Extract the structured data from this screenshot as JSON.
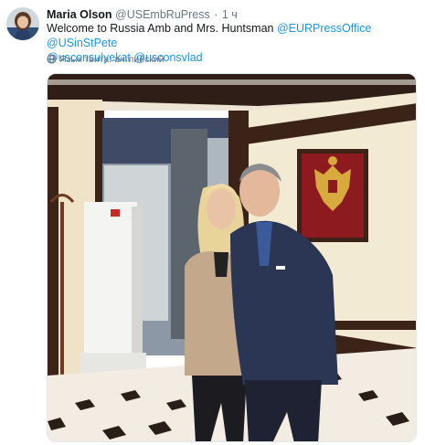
{
  "tweet": {
    "author": {
      "display_name": "Maria Olson",
      "handle": "@USEmbRuPress",
      "avatar_icon": "profile-photo"
    },
    "separator": "·",
    "time": "1 ч",
    "text_intro": "Welcome to Russia Amb and Mrs. Huntsman",
    "mentions": [
      "@EURPressOffice",
      "@USinStPete",
      "@usconsulyekat",
      "@usconsvlad"
    ],
    "language_label": "Язык твита: английский",
    "language_icon": "globe-icon",
    "media": {
      "type": "photo",
      "colors": {
        "wall": "#f3ead4",
        "wood": "#3b2318",
        "floor": "#f2ece2",
        "coat": "#2b3554",
        "sweater": "#c4a88c",
        "emblem_bg": "#8c1a1e",
        "emblem_gold": "#d8a93c"
      }
    },
    "colors": {
      "link": "#1b95e0",
      "secondary": "#657786",
      "text": "#14171a"
    }
  }
}
